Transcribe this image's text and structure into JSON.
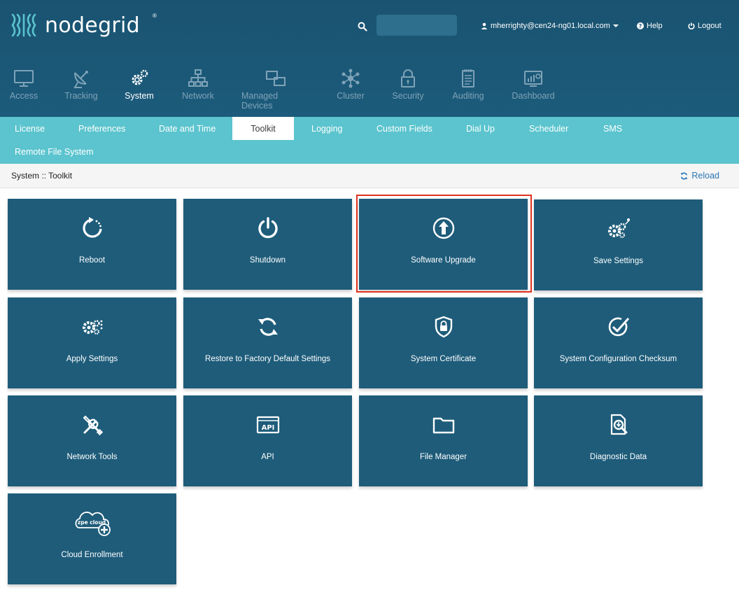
{
  "header": {
    "logo_text": "nodegrid",
    "search": {
      "value": "",
      "placeholder": ""
    },
    "user_label": "mherrighty@cen24-ng01.local.com",
    "help_label": "Help",
    "logout_label": "Logout"
  },
  "main_nav": [
    {
      "label": "Access",
      "icon": "monitor-icon",
      "active": false
    },
    {
      "label": "Tracking",
      "icon": "satellite-dish-icon",
      "active": false
    },
    {
      "label": "System",
      "icon": "gears-icon",
      "active": true
    },
    {
      "label": "Network",
      "icon": "network-tree-icon",
      "active": false
    },
    {
      "label": "Managed Devices",
      "icon": "devices-icon",
      "active": false
    },
    {
      "label": "Cluster",
      "icon": "cluster-icon",
      "active": false
    },
    {
      "label": "Security",
      "icon": "lock-icon",
      "active": false
    },
    {
      "label": "Auditing",
      "icon": "notepad-icon",
      "active": false
    },
    {
      "label": "Dashboard",
      "icon": "dashboard-icon",
      "active": false
    }
  ],
  "sub_nav": [
    {
      "label": "License",
      "active": false
    },
    {
      "label": "Preferences",
      "active": false
    },
    {
      "label": "Date and Time",
      "active": false
    },
    {
      "label": "Toolkit",
      "active": true
    },
    {
      "label": "Logging",
      "active": false
    },
    {
      "label": "Custom Fields",
      "active": false
    },
    {
      "label": "Dial Up",
      "active": false
    },
    {
      "label": "Scheduler",
      "active": false
    },
    {
      "label": "SMS",
      "active": false
    },
    {
      "label": "Remote File System",
      "active": false
    }
  ],
  "breadcrumb": "System :: Toolkit",
  "reload_label": "Reload",
  "tiles": [
    {
      "label": "Reboot",
      "icon": "reboot-icon"
    },
    {
      "label": "Shutdown",
      "icon": "power-icon"
    },
    {
      "label": "Software Upgrade",
      "icon": "upload-arrow-icon",
      "highlighted": true
    },
    {
      "label": "Save Settings",
      "icon": "save-settings-icon"
    },
    {
      "label": "Apply Settings",
      "icon": "apply-settings-icon"
    },
    {
      "label": "Restore to Factory Default Settings",
      "icon": "restore-icon"
    },
    {
      "label": "System Certificate",
      "icon": "shield-lock-icon"
    },
    {
      "label": "System Configuration Checksum",
      "icon": "check-circle-icon"
    },
    {
      "label": "Network Tools",
      "icon": "tools-icon"
    },
    {
      "label": "API",
      "icon": "api-icon"
    },
    {
      "label": "File Manager",
      "icon": "folder-icon"
    },
    {
      "label": "Diagnostic Data",
      "icon": "diagnostic-icon"
    },
    {
      "label": "Cloud Enrollment",
      "icon": "zpe-cloud-icon",
      "icon_text": "zpe cloud"
    }
  ],
  "colors": {
    "header_bg": "#1c5b7b",
    "subnav_bg": "#5bc4ce",
    "tile_bg": "#1e5c7a",
    "highlight": "#e0321f",
    "link": "#2a77b5"
  }
}
